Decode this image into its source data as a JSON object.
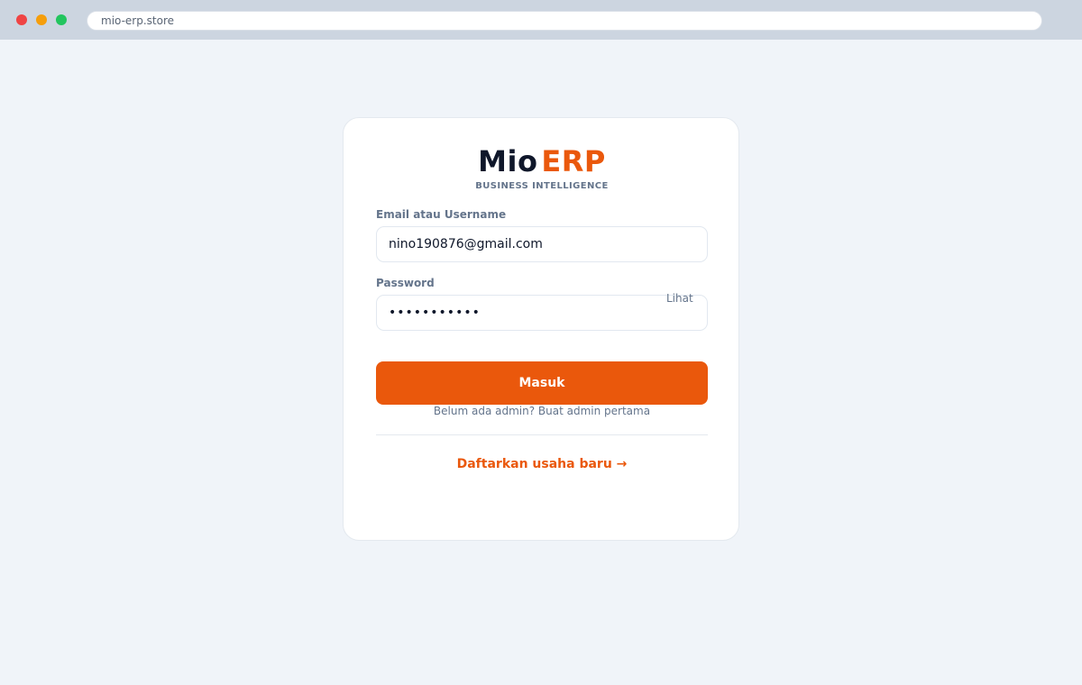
{
  "browser": {
    "url": "mio-erp.store"
  },
  "brand": {
    "name_part1": "Mio",
    "name_part2": "ERP",
    "tagline": "BUSINESS INTELLIGENCE",
    "colors": {
      "accent": "#ea580c",
      "dark": "#0f172a"
    }
  },
  "login_form": {
    "email_label": "Email atau Username",
    "email_value": "nino190876@gmail.com",
    "password_label": "Password",
    "password_value": "•••••••••••",
    "show_password_label": "Lihat",
    "submit_label": "Masuk",
    "create_admin_hint": "Belum ada admin? Buat admin pertama",
    "register_link": "Daftarkan usaha baru →"
  },
  "icons": {
    "window_controls": [
      "close-dot-icon",
      "minimize-dot-icon",
      "maximize-dot-icon"
    ]
  }
}
